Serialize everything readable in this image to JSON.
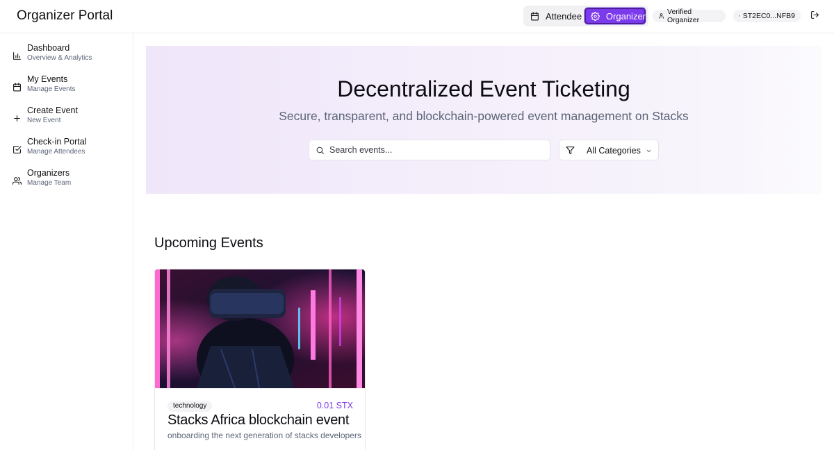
{
  "header": {
    "title": "Organizer Portal",
    "mode_switch": {
      "attendee_label": "Attendee",
      "organizer_label": "Organizer",
      "active": "Organizer"
    },
    "verified_label": "Verified Organizer",
    "wallet_label": "ST2EC0...NFB9"
  },
  "sidebar": {
    "items": [
      {
        "label": "Dashboard",
        "sub": "Overview & Analytics",
        "icon": "bar-chart-icon"
      },
      {
        "label": "My Events",
        "sub": "Manage Events",
        "icon": "calendar-icon"
      },
      {
        "label": "Create Event",
        "sub": "New Event",
        "icon": "plus-icon"
      },
      {
        "label": "Check-in Portal",
        "sub": "Manage Attendees",
        "icon": "check-square-icon"
      },
      {
        "label": "Organizers",
        "sub": "Manage Team",
        "icon": "users-icon"
      }
    ]
  },
  "hero": {
    "title": "Decentralized Event Ticketing",
    "subtitle": "Secure, transparent, and blockchain-powered event management on Stacks",
    "search_placeholder": "Search events...",
    "category_value": "All Categories"
  },
  "upcoming": {
    "title": "Upcoming Events",
    "events": [
      {
        "category": "technology",
        "price": "0.01 STX",
        "title": "Stacks Africa blockchain event",
        "description": "onboarding the next generation of stacks developers"
      }
    ]
  },
  "colors": {
    "accent": "#7c3aed",
    "muted_text": "#5b6477",
    "hero_tint": "#efe6fa"
  }
}
